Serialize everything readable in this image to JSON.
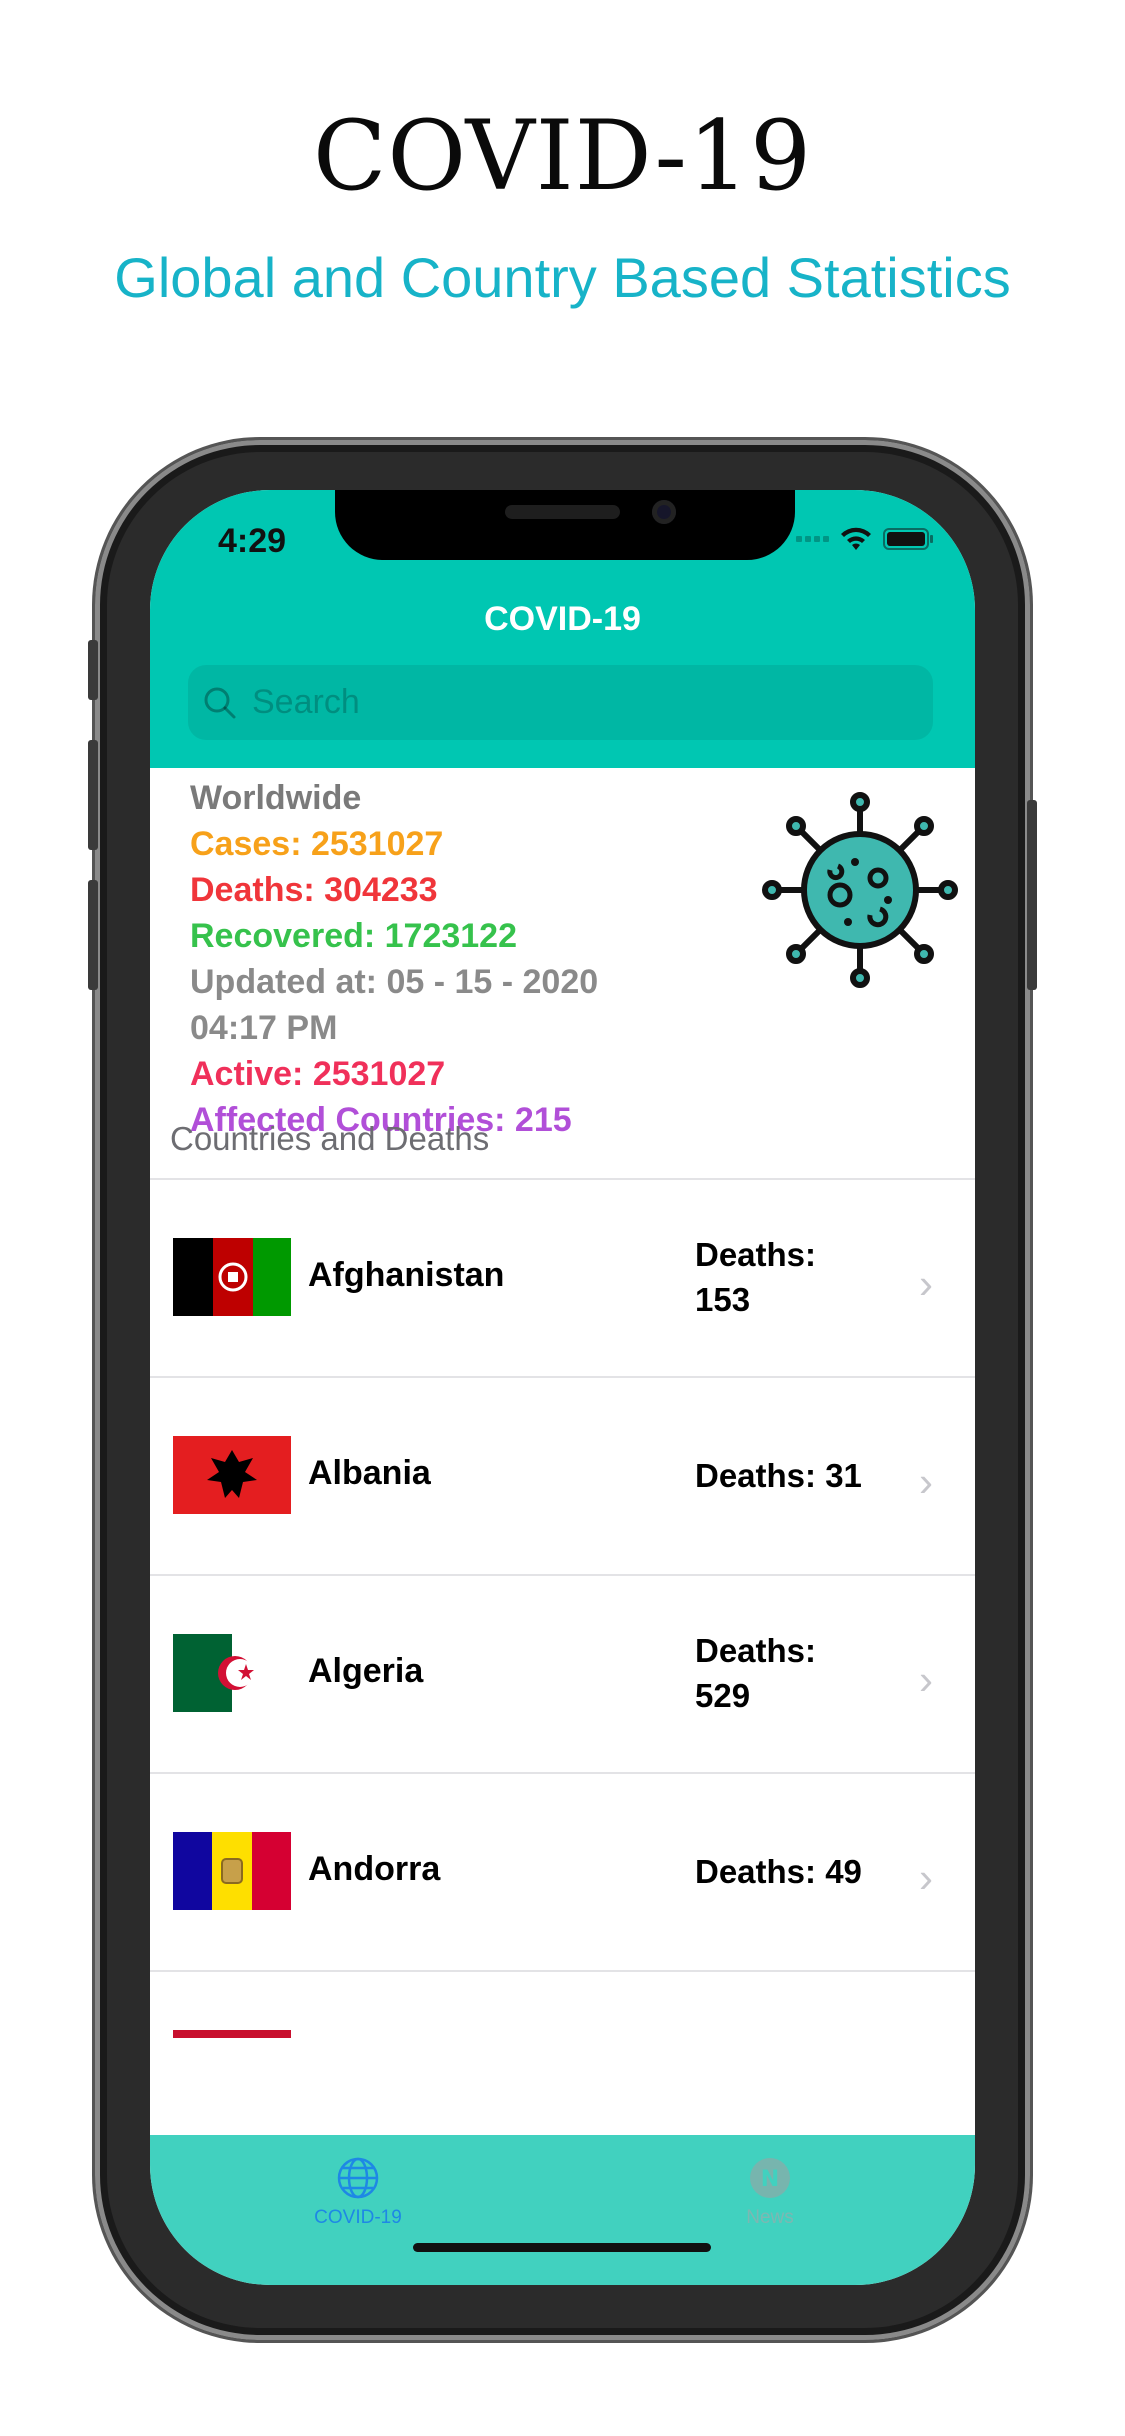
{
  "promo": {
    "title": "COVID-19",
    "subtitle": "Global and Country Based Statistics"
  },
  "status_bar": {
    "time": "4:29"
  },
  "nav": {
    "title": "COVID-19",
    "search_placeholder": "Search"
  },
  "worldwide": {
    "heading": "Worldwide",
    "cases": "Cases: 2531027",
    "deaths": "Deaths: 304233",
    "recovered": "Recovered: 1723122",
    "updated": "Updated at: 05 - 15 - 2020",
    "updated_time": "04:17 PM",
    "active": "Active: 2531027",
    "affected": "Affected Countries: 215",
    "colors": {
      "heading": "#7a7a7a",
      "cases": "#f7a11a",
      "deaths": "#f0353a",
      "recovered": "#36c24c",
      "updated": "#8a8a8a",
      "active": "#f0305a",
      "affected": "#b14fd8"
    }
  },
  "section": {
    "header": "Countries and Deaths"
  },
  "countries": [
    {
      "name": "Afghanistan",
      "deaths_label": "Deaths:",
      "deaths_value": "153",
      "flag": "afghanistan-flag"
    },
    {
      "name": "Albania",
      "deaths_label": "Deaths: 31",
      "deaths_value": "",
      "flag": "albania-flag"
    },
    {
      "name": "Algeria",
      "deaths_label": "Deaths:",
      "deaths_value": "529",
      "flag": "algeria-flag"
    },
    {
      "name": "Andorra",
      "deaths_label": "Deaths: 49",
      "deaths_value": "",
      "flag": "andorra-flag"
    }
  ],
  "tabbar": {
    "tabs": [
      {
        "label": "COVID-19",
        "icon": "globe-icon",
        "active": true
      },
      {
        "label": "News",
        "icon": "news-icon",
        "active": false
      }
    ]
  },
  "theme": {
    "accent": "#00c7b2",
    "tabbar": "#41d1bf",
    "tab_active": "#1e88e5",
    "promo_subtitle": "#17b3c8"
  }
}
